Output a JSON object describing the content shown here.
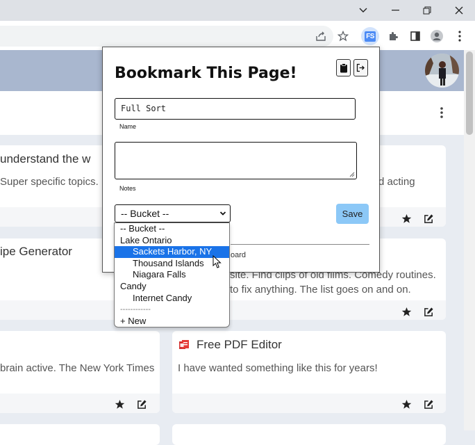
{
  "browser": {
    "extension_badge": "FS"
  },
  "popup": {
    "title": "Bookmark This Page!",
    "name_value": "Full Sort",
    "name_label": "Name",
    "notes_value": "",
    "notes_label": "Notes",
    "bucket_selected": "-- Bucket --",
    "save_label": "Save",
    "partial_text": "oard"
  },
  "dropdown": {
    "options": [
      {
        "label": "-- Bucket --",
        "indent": false,
        "selected": false
      },
      {
        "label": "Lake Ontario",
        "indent": false,
        "selected": false
      },
      {
        "label": "Sackets Harbor, NY",
        "indent": true,
        "selected": true
      },
      {
        "label": "Thousand Islands",
        "indent": true,
        "selected": false
      },
      {
        "label": "Niagara Falls",
        "indent": true,
        "selected": false
      },
      {
        "label": "Candy",
        "indent": false,
        "selected": false
      },
      {
        "label": "Internet Candy",
        "indent": true,
        "selected": false
      },
      {
        "label": "------------",
        "indent": false,
        "selected": false
      },
      {
        "label": "+ New",
        "indent": false,
        "selected": false
      }
    ]
  },
  "cards": {
    "c1": {
      "title": "understand the w",
      "text": "Super specific topics.",
      "text_right": "d acting"
    },
    "c2": {
      "title": "ipe Generator",
      "text": ""
    },
    "c3": {
      "text_line1": "site. Find clips of old films. Comedy routines.",
      "text_line2": "to fix anything. The list goes on and on."
    },
    "c4": {
      "text": "brain active. The New York Times"
    },
    "c5": {
      "title": "Free PDF Editor",
      "text": "I have wanted something like this for years!"
    }
  },
  "colors": {
    "header": "#a9b7cf",
    "save_button": "#8cc8f7",
    "selected_option": "#1a73e8",
    "pdf_icon": "#d32f2f"
  }
}
